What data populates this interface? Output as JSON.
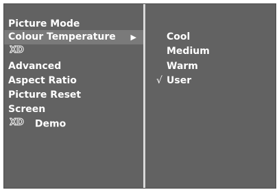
{
  "menu": {
    "items": [
      {
        "label": "Picture Mode"
      },
      {
        "label": "Colour Temperature",
        "arrow": "▶"
      },
      {
        "label": "XD"
      },
      {
        "label": "Advanced"
      },
      {
        "label": "Aspect Ratio"
      },
      {
        "label": "Picture Reset"
      },
      {
        "label": "Screen"
      },
      {
        "label": "XD Demo",
        "suffix": "Demo"
      }
    ]
  },
  "submenu": {
    "items": [
      {
        "label": "Cool"
      },
      {
        "label": "Medium"
      },
      {
        "label": "Warm"
      },
      {
        "label": "User",
        "checked": true
      }
    ],
    "check_mark": "√"
  },
  "colors": {
    "panel": "#626262",
    "selected": "#7a7a7a",
    "divider": "#d9d9d9",
    "text": "#ffffff"
  }
}
